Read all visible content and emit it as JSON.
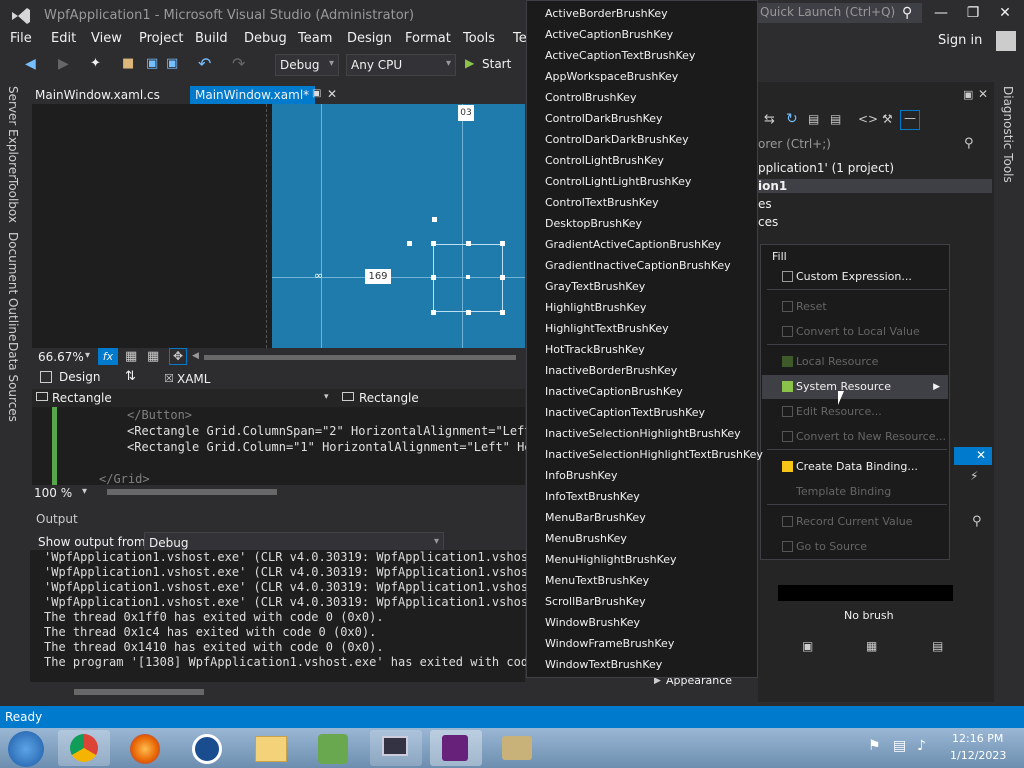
{
  "window": {
    "title": "WpfApplication1 - Microsoft Visual Studio (Administrator)",
    "quick_launch": "Quick Launch (Ctrl+Q)",
    "sign_in": "Sign in"
  },
  "menu": [
    "File",
    "Edit",
    "View",
    "Project",
    "Build",
    "Debug",
    "Team",
    "Design",
    "Format",
    "Tools",
    "Te"
  ],
  "toolbar": {
    "config": "Debug",
    "platform": "Any CPU",
    "start": "Start"
  },
  "left_tabs": [
    "Server Explorer",
    "Toolbox",
    "Document Outline",
    "Data Sources"
  ],
  "doc_tabs": [
    "MainWindow.xaml.cs",
    "MainWindow.xaml*"
  ],
  "designer": {
    "marker_top": "03",
    "marker_left": "169",
    "zoom": "66.67%",
    "fx": "fx"
  },
  "split_tabs": {
    "design": "Design",
    "swap": "⇅",
    "xaml": "XAML"
  },
  "xml_nav": {
    "left": "Rectangle",
    "right": "Rectangle"
  },
  "code_lines": [
    "</Button>",
    "<Rectangle Grid.ColumnSpan=\"2\" HorizontalAlignment=\"Left\"",
    "<Rectangle Grid.Column=\"1\" HorizontalAlignment=\"Left\" Hei",
    "</Grid>"
  ],
  "editor_zoom": "100 %",
  "output": {
    "title": "Output",
    "show_from_label": "Show output from:",
    "source": "Debug",
    "lines": [
      "'WpfApplication1.vshost.exe' (CLR v4.0.30319: WpfApplication1.vshost.",
      "'WpfApplication1.vshost.exe' (CLR v4.0.30319: WpfApplication1.vshost.",
      "'WpfApplication1.vshost.exe' (CLR v4.0.30319: WpfApplication1.vshost.",
      "'WpfApplication1.vshost.exe' (CLR v4.0.30319: WpfApplication1.vshost.",
      "The thread 0x1ff0 has exited with code 0 (0x0).",
      "The thread 0x1c4 has exited with code 0 (0x0).",
      "The thread 0x1410 has exited with code 0 (0x0).",
      "The program '[1308] WpfApplication1.vshost.exe' has exited with code"
    ]
  },
  "brush_keys": [
    "ActiveBorderBrushKey",
    "ActiveCaptionBrushKey",
    "ActiveCaptionTextBrushKey",
    "AppWorkspaceBrushKey",
    "ControlBrushKey",
    "ControlDarkBrushKey",
    "ControlDarkDarkBrushKey",
    "ControlLightBrushKey",
    "ControlLightLightBrushKey",
    "ControlTextBrushKey",
    "DesktopBrushKey",
    "GradientActiveCaptionBrushKey",
    "GradientInactiveCaptionBrushKey",
    "GrayTextBrushKey",
    "HighlightBrushKey",
    "HighlightTextBrushKey",
    "HotTrackBrushKey",
    "InactiveBorderBrushKey",
    "InactiveCaptionBrushKey",
    "InactiveCaptionTextBrushKey",
    "InactiveSelectionHighlightBrushKey",
    "InactiveSelectionHighlightTextBrushKey",
    "InfoBrushKey",
    "InfoTextBrushKey",
    "MenuBarBrushKey",
    "MenuBrushKey",
    "MenuHighlightBrushKey",
    "MenuTextBrushKey",
    "ScrollBarBrushKey",
    "WindowBrushKey",
    "WindowFrameBrushKey",
    "WindowTextBrushKey"
  ],
  "solution_explorer": {
    "search": "orer (Ctrl+;)",
    "items": [
      "pplication1' (1 project)",
      "ion1",
      "es",
      "ces"
    ]
  },
  "context_menu": {
    "header": "Fill",
    "items": [
      {
        "label": "Custom Expression...",
        "enabled": true,
        "icon": "empty-box"
      },
      {
        "label": "Reset",
        "enabled": false,
        "icon": "empty-box"
      },
      {
        "label": "Convert to Local Value",
        "enabled": false,
        "icon": "empty-box"
      },
      {
        "label": "Local Resource",
        "enabled": false,
        "icon": "green-box"
      },
      {
        "label": "System Resource",
        "enabled": true,
        "icon": "green-box",
        "submenu": true
      },
      {
        "label": "Edit Resource...",
        "enabled": false,
        "icon": "empty-box"
      },
      {
        "label": "Convert to New Resource...",
        "enabled": false,
        "icon": "empty-box"
      },
      {
        "label": "Create Data Binding...",
        "enabled": true,
        "icon": "yellow-box"
      },
      {
        "label": "Template Binding",
        "enabled": false,
        "icon": "none"
      },
      {
        "label": "Record Current Value",
        "enabled": false,
        "icon": "empty-box"
      },
      {
        "label": "Go to Source",
        "enabled": false,
        "icon": "empty-box"
      }
    ]
  },
  "properties": {
    "no_brush": "No brush",
    "appearance": "Appearance"
  },
  "right_tab": "Diagnostic Tools",
  "status": "Ready",
  "clock": {
    "time": "12:16 PM",
    "date": "1/12/2023"
  },
  "colors": {
    "accent": "#007acc",
    "canvas": "#1f7bac",
    "menu_bg": "#1b1b1c"
  }
}
